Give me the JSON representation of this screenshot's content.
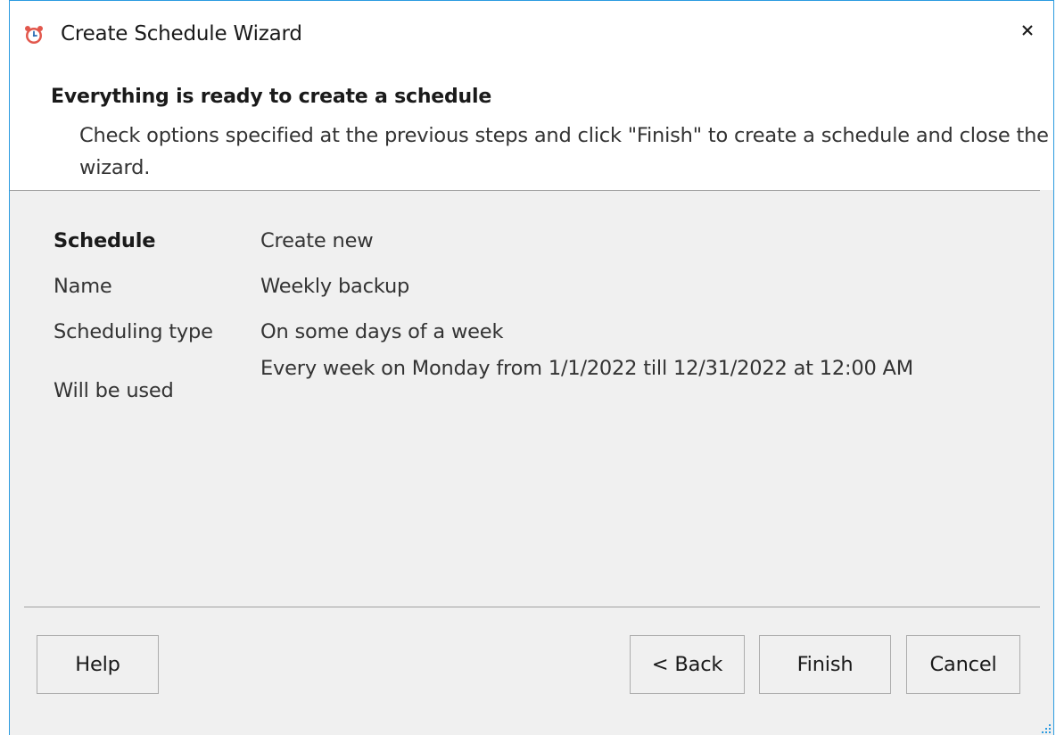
{
  "window": {
    "title": "Create Schedule Wizard",
    "icon": "alarm-clock-icon",
    "close_icon": "close-icon"
  },
  "header": {
    "title": "Everything is ready to create a schedule",
    "description": "Check options specified at the previous steps and click \"Finish\" to create a schedule and close the wizard."
  },
  "summary": {
    "rows": [
      {
        "label": "Schedule",
        "value": "Create new"
      },
      {
        "label": "Name",
        "value": "Weekly backup"
      },
      {
        "label": "Scheduling type",
        "value": "On some days of a week"
      },
      {
        "label": "Will be used",
        "value": "Every week on Monday from 1/1/2022 till 12/31/2022 at 12:00 AM"
      }
    ]
  },
  "buttons": {
    "help": "Help",
    "back": "< Back",
    "finish": "Finish",
    "cancel": "Cancel"
  },
  "colors": {
    "window_border": "#2b9be0",
    "background": "#f0f0f0",
    "header_background": "#ffffff"
  }
}
